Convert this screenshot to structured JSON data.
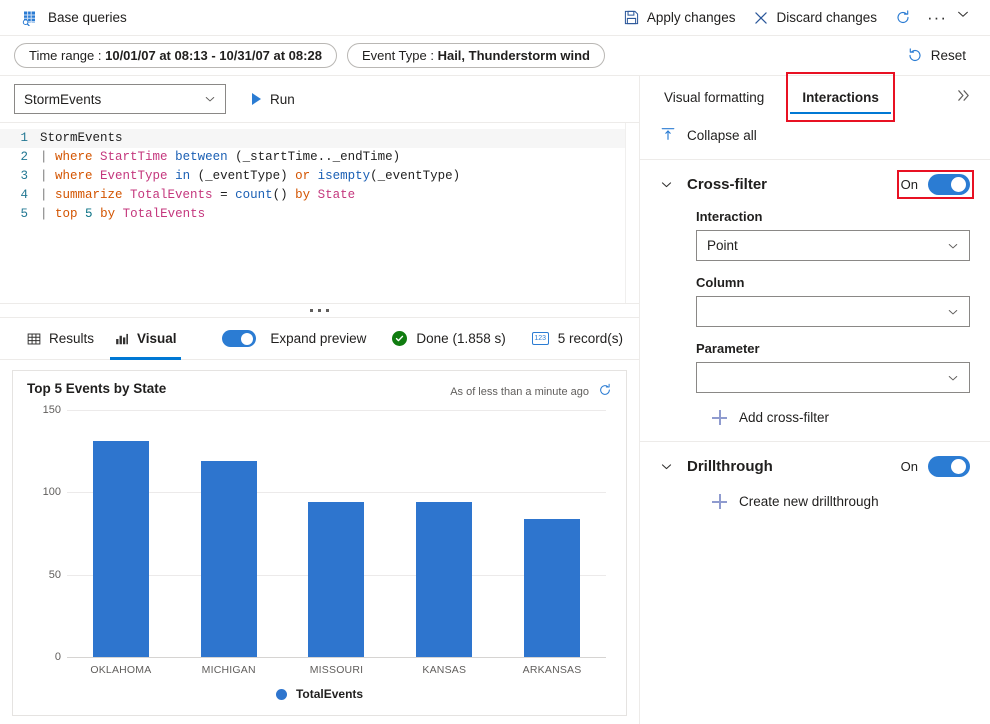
{
  "topbar": {
    "icon": "table-search-icon",
    "title": "Base queries",
    "apply_label": "Apply changes",
    "apply_icon": "save-icon",
    "discard_label": "Discard changes",
    "discard_icon": "close-x-icon",
    "refresh_icon": "refresh-icon",
    "more_label": "···",
    "chevron_icon": "chevron-down-icon"
  },
  "filterbar": {
    "pills": [
      {
        "label": "Time range : ",
        "value": "10/01/07 at 08:13 - 10/31/07 at 08:28"
      },
      {
        "label": "Event Type : ",
        "value": "Hail, Thunderstorm wind"
      }
    ],
    "reset_label": "Reset",
    "reset_icon": "undo-icon"
  },
  "query": {
    "source_value": "StormEvents",
    "source_chevron": "chevron-down-icon",
    "run_label": "Run",
    "run_icon": "play-icon",
    "lines": [
      {
        "n": "1",
        "tokens": [
          {
            "t": "StormEvents",
            "c": "k-plain"
          }
        ]
      },
      {
        "n": "2",
        "tokens": [
          {
            "t": "| ",
            "c": "k-pipe"
          },
          {
            "t": "where",
            "c": "k-op"
          },
          {
            "t": " ",
            "c": "k-plain"
          },
          {
            "t": "StartTime",
            "c": "k-col"
          },
          {
            "t": " ",
            "c": "k-plain"
          },
          {
            "t": "between",
            "c": "k-fn"
          },
          {
            "t": " (_startTime.._endTime)",
            "c": "k-plain"
          }
        ]
      },
      {
        "n": "3",
        "tokens": [
          {
            "t": "| ",
            "c": "k-pipe"
          },
          {
            "t": "where",
            "c": "k-op"
          },
          {
            "t": " ",
            "c": "k-plain"
          },
          {
            "t": "EventType",
            "c": "k-col"
          },
          {
            "t": " ",
            "c": "k-plain"
          },
          {
            "t": "in",
            "c": "k-fn"
          },
          {
            "t": " (_eventType) ",
            "c": "k-plain"
          },
          {
            "t": "or",
            "c": "k-op"
          },
          {
            "t": " ",
            "c": "k-plain"
          },
          {
            "t": "isempty",
            "c": "k-fn"
          },
          {
            "t": "(_eventType)",
            "c": "k-plain"
          }
        ]
      },
      {
        "n": "4",
        "tokens": [
          {
            "t": "| ",
            "c": "k-pipe"
          },
          {
            "t": "summarize",
            "c": "k-op"
          },
          {
            "t": " ",
            "c": "k-plain"
          },
          {
            "t": "TotalEvents",
            "c": "k-col"
          },
          {
            "t": " = ",
            "c": "k-plain"
          },
          {
            "t": "count",
            "c": "k-fn"
          },
          {
            "t": "() ",
            "c": "k-plain"
          },
          {
            "t": "by",
            "c": "k-op"
          },
          {
            "t": " ",
            "c": "k-plain"
          },
          {
            "t": "State",
            "c": "k-col"
          }
        ]
      },
      {
        "n": "5",
        "tokens": [
          {
            "t": "| ",
            "c": "k-pipe"
          },
          {
            "t": "top",
            "c": "k-op"
          },
          {
            "t": " ",
            "c": "k-plain"
          },
          {
            "t": "5",
            "c": "k-num"
          },
          {
            "t": " ",
            "c": "k-plain"
          },
          {
            "t": "by",
            "c": "k-op"
          },
          {
            "t": " ",
            "c": "k-plain"
          },
          {
            "t": "TotalEvents",
            "c": "k-col"
          }
        ]
      }
    ]
  },
  "results": {
    "tabs": [
      {
        "label": "Results",
        "icon": "table-icon",
        "active": false
      },
      {
        "label": "Visual",
        "icon": "bar-chart-icon",
        "active": true
      }
    ],
    "expand_preview_label": "Expand preview",
    "expand_preview_on": true,
    "status_label": "Done (1.858 s)",
    "status_icon": "check-circle-icon",
    "records_label": "5 record(s)",
    "records_icon": "number-badge-icon"
  },
  "chart_data": {
    "type": "bar",
    "title": "Top 5 Events by State",
    "as_of": "As of less than a minute ago",
    "refresh_icon": "refresh-icon",
    "categories": [
      "OKLAHOMA",
      "MICHIGAN",
      "MISSOURI",
      "KANSAS",
      "ARKANSAS"
    ],
    "values": [
      131,
      119,
      94,
      94,
      84
    ],
    "series": [
      {
        "name": "TotalEvents",
        "values": [
          131,
          119,
          94,
          94,
          84
        ],
        "color": "#2e75ce"
      }
    ],
    "yticks": [
      150,
      100,
      50,
      0
    ],
    "ylim": [
      0,
      150
    ],
    "xlabel": "",
    "ylabel": "",
    "grid": true,
    "legend": {
      "position": "bottom",
      "entries": [
        "TotalEvents"
      ]
    }
  },
  "panel": {
    "tabs": [
      {
        "label": "Visual formatting",
        "active": false,
        "highlighted": false
      },
      {
        "label": "Interactions",
        "active": true,
        "highlighted": true
      }
    ],
    "expand_icon": "double-chevron-right-icon",
    "collapse_all_label": "Collapse all",
    "collapse_all_icon": "collapse-all-icon",
    "sections": [
      {
        "title": "Cross-filter",
        "chevron": "chevron-down-icon",
        "toggle_label": "On",
        "toggle_on": true,
        "toggle_highlighted": true,
        "fields": [
          {
            "label": "Interaction",
            "value": "Point",
            "chevron": "chevron-down-icon"
          },
          {
            "label": "Column",
            "value": "",
            "chevron": "chevron-down-icon"
          },
          {
            "label": "Parameter",
            "value": "",
            "chevron": "chevron-down-icon"
          }
        ],
        "add_label": "Add cross-filter",
        "add_icon": "plus-icon"
      },
      {
        "title": "Drillthrough",
        "chevron": "chevron-down-icon",
        "toggle_label": "On",
        "toggle_on": true,
        "toggle_highlighted": false,
        "fields": [],
        "add_label": "Create new drillthrough",
        "add_icon": "plus-icon"
      }
    ]
  }
}
